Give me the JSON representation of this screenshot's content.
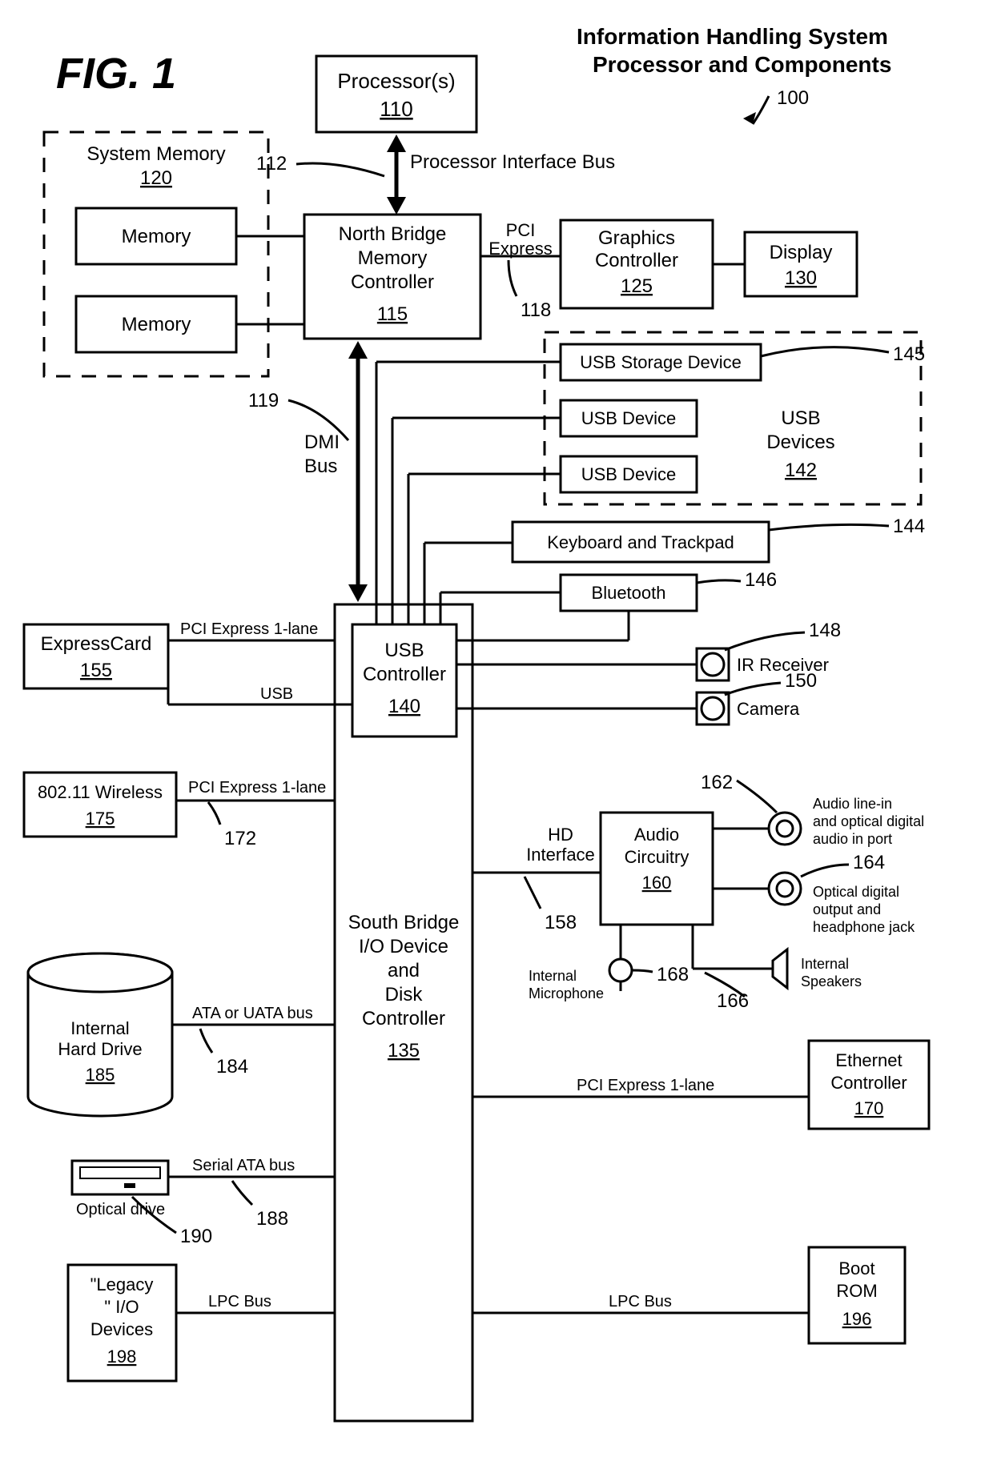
{
  "fig_label": "FIG. 1",
  "title_l1": "Information Handling System",
  "title_l2": "Processor and Components",
  "ref_main": "100",
  "blocks": {
    "processors": {
      "label": "Processor(s)",
      "ref": "110"
    },
    "sysmem": {
      "label": "System Memory",
      "ref": "120",
      "item1": "Memory",
      "item2": "Memory"
    },
    "northbridge": {
      "l1": "North Bridge",
      "l2": "Memory",
      "l3": "Controller",
      "ref": "115"
    },
    "graphics": {
      "l1": "Graphics",
      "l2": "Controller",
      "ref": "125"
    },
    "display": {
      "label": "Display",
      "ref": "130"
    },
    "usbstorage": {
      "label": "USB Storage Device",
      "ref_out": "145"
    },
    "usbdev1": {
      "label": "USB Device"
    },
    "usbdev2": {
      "label": "USB Device"
    },
    "usbdevices_group": {
      "l1": "USB",
      "l2": "Devices",
      "ref": "142"
    },
    "keyboard": {
      "label": "Keyboard and Trackpad",
      "ref_out": "144"
    },
    "bluetooth": {
      "label": "Bluetooth",
      "ref_out": "146"
    },
    "ir": {
      "label": "IR Receiver",
      "ref_out": "148"
    },
    "camera": {
      "label": "Camera",
      "ref_out": "150"
    },
    "expresscard": {
      "label": "ExpressCard",
      "ref": "155"
    },
    "usbctrl": {
      "l1": "USB",
      "l2": "Controller",
      "ref": "140"
    },
    "wireless": {
      "label": "802.11 Wireless",
      "ref": "175"
    },
    "southbridge": {
      "l1": "South Bridge",
      "l2": "I/O Device",
      "l3": "and",
      "l4": "Disk",
      "l5": "Controller",
      "ref": "135"
    },
    "audio": {
      "l1": "Audio",
      "l2": "Circuitry",
      "ref": "160"
    },
    "line_in": {
      "l1": "Audio line-in",
      "l2": "and optical digital",
      "l3": "audio in port",
      "ref_out": "162"
    },
    "opt_out": {
      "l1": "Optical digital",
      "l2": "output and",
      "l3": "headphone jack",
      "ref_out": "164"
    },
    "mic": {
      "l1": "Internal",
      "l2": "Microphone",
      "ref_out": "168"
    },
    "spk": {
      "l1": "Internal",
      "l2": "Speakers",
      "ref_out": "166"
    },
    "ethernet": {
      "l1": "Ethernet",
      "l2": "Controller",
      "ref": "170"
    },
    "hdd": {
      "l1": "Internal",
      "l2": "Hard Drive",
      "ref": "185"
    },
    "optical": {
      "label": "Optical drive",
      "ref_out": "190"
    },
    "legacy": {
      "l1": "\"Legacy",
      "l2": "\" I/O",
      "l3": "Devices",
      "ref": "198"
    },
    "bootrom": {
      "l1": "Boot",
      "l2": "ROM",
      "ref": "196"
    }
  },
  "buses": {
    "proc_iface": "Processor Interface Bus",
    "pci_express": {
      "l1": "PCI",
      "l2": "Express"
    },
    "dmi": {
      "l1": "DMI",
      "l2": "Bus"
    },
    "pci1lane": "PCI Express 1-lane",
    "usb": "USB",
    "hd": {
      "l1": "HD",
      "l2": "Interface"
    },
    "ata": "ATA or UATA bus",
    "sata": "Serial ATA bus",
    "lpc": "LPC Bus"
  },
  "refs": {
    "proc_bus": "112",
    "pci_express": "118",
    "dmi": "119",
    "pci1_a": "172",
    "hd": "158",
    "ata": "184",
    "sata": "188"
  }
}
